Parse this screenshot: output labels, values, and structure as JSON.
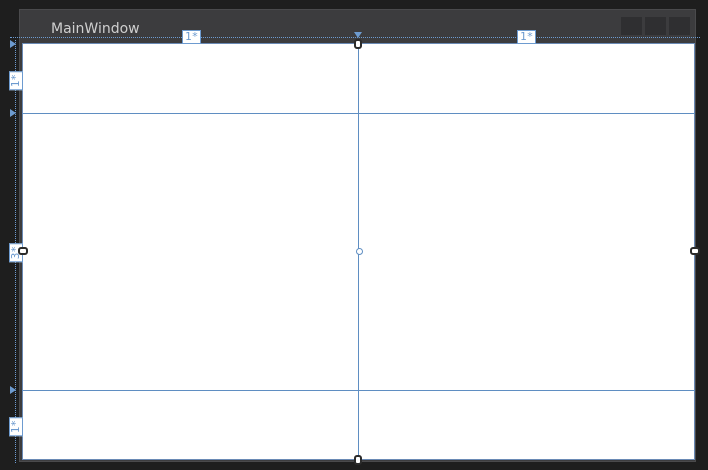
{
  "window": {
    "title": "MainWindow"
  },
  "grid": {
    "column_definitions": [
      "1*",
      "1*"
    ],
    "row_definitions": [
      "1*",
      "3*",
      "1*"
    ]
  },
  "colors": {
    "canvas_background": "#1e1e1e",
    "window_chrome": "#3c3c3e",
    "client_area": "#ffffff",
    "grid_line": "#5f8ec2",
    "ruler_accent": "#6d9bd0"
  }
}
